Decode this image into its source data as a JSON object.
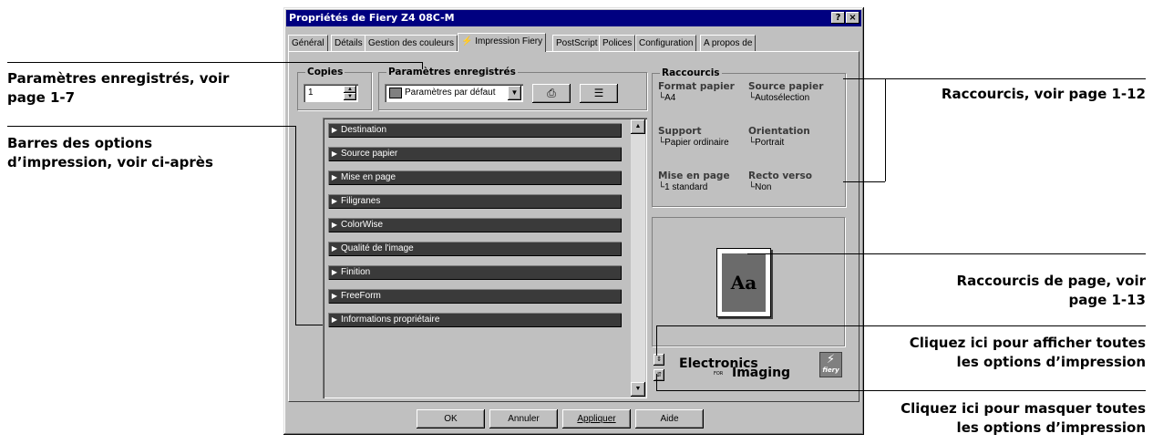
{
  "dialog": {
    "title": "Propriétés de Fiery Z4 08C-M",
    "help_button": "?",
    "close_button": "×"
  },
  "tabs": [
    {
      "label": "Général"
    },
    {
      "label": "Détails"
    },
    {
      "label": "Gestion des couleurs"
    },
    {
      "label": "Impression Fiery",
      "active": true
    },
    {
      "label": "PostScript"
    },
    {
      "label": "Polices"
    },
    {
      "label": "Configuration"
    },
    {
      "label": "A propos de"
    }
  ],
  "copies": {
    "legend": "Copies",
    "value": "1"
  },
  "saved_settings": {
    "legend": "Paramètres enregistrés",
    "selected": "Paramètres par défaut"
  },
  "print_option_bars": [
    "Destination",
    "Source papier",
    "Mise en page",
    "Filigranes",
    "ColorWise",
    "Qualité de l'image",
    "Finition",
    "FreeForm",
    "Informations propriétaire"
  ],
  "shortcuts": {
    "legend": "Raccourcis",
    "items": [
      {
        "title": "Format papier",
        "value": "A4"
      },
      {
        "title": "Source papier",
        "value": "Autosélection"
      },
      {
        "title": "Support",
        "value": "Papier ordinaire"
      },
      {
        "title": "Orientation",
        "value": "Portrait"
      },
      {
        "title": "Mise en page",
        "value": "1 standard"
      },
      {
        "title": "Recto verso",
        "value": "Non"
      }
    ]
  },
  "preview": {
    "sample": "Aa"
  },
  "logo": {
    "line1": "Electronics",
    "for": "FOR",
    "line2": "Imaging",
    "fiery": "fiery"
  },
  "buttons": {
    "ok": "OK",
    "cancel": "Annuler",
    "apply": "Appliquer",
    "help": "Aide"
  },
  "callouts": {
    "saved_line1": "Paramètres enregistrés, voir",
    "saved_line2": "page 1-7",
    "bars_line1": "Barres des options",
    "bars_line2": "d’impression, voir ci-après",
    "shortcuts": "Raccourcis, voir page 1-12",
    "page_line1": "Raccourcis de page, voir",
    "page_line2": "page 1-13",
    "show_line1": "Cliquez ici pour afficher toutes",
    "show_line2": "les options d’impression",
    "hide_line1": "Cliquez ici pour masquer toutes",
    "hide_line2": "les options d’impression"
  }
}
